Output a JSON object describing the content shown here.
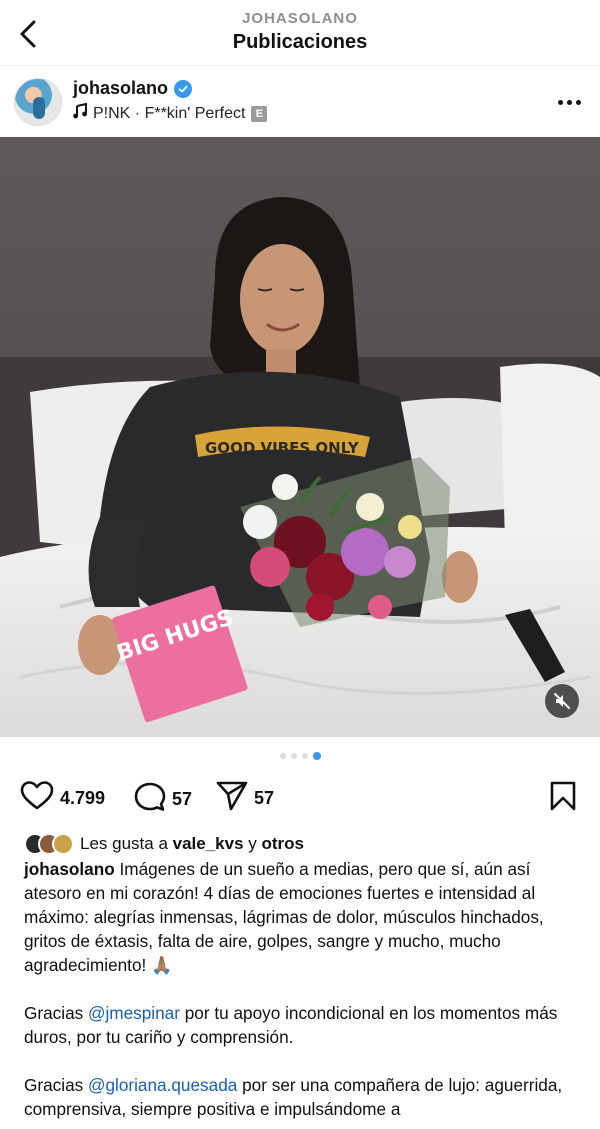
{
  "header": {
    "account": "JOHASOLANO",
    "title": "Publicaciones"
  },
  "post": {
    "username": "johasolano",
    "song": "P!NK · F**kin' Perfect",
    "explicit_badge": "E",
    "image_card_text": "BIG HUGS",
    "sweatshirt_text": "GOOD VIBES ONLY",
    "carousel": {
      "total": 4,
      "active_index": 3
    }
  },
  "actions": {
    "likes": "4.799",
    "comments": "57",
    "shares": "57"
  },
  "liked_by": {
    "prefix": "Les gusta a",
    "user": "vale_kvs",
    "connector": "y",
    "others": "otros"
  },
  "caption": {
    "p1_text": "Imágenes de un sueño a medias, pero que sí, aún así atesoro en mi corazón! 4 días de emociones fuertes e intensidad al máximo: alegrías inmensas, lágrimas de dolor, músculos hinchados, gritos de éxtasis, falta de aire, golpes, sangre y mucho, mucho agradecimiento! 🙏🏽",
    "p2_prefix": "Gracias",
    "p2_mention": "@jmespinar",
    "p2_text": "por tu apoyo incondicional en los momentos más duros, por tu cariño y comprensión.",
    "p3_prefix": "Gracias",
    "p3_mention": "@gloriana.quesada",
    "p3_text": "por ser una compañera de lujo: aguerrida, comprensiva, siempre positiva e impulsándome a"
  },
  "colors": {
    "accent": "#3897f0",
    "mention": "#1a5fb4",
    "muted": "#8e8e8e"
  },
  "icons": [
    "back-arrow-icon",
    "verified-badge-icon",
    "music-note-icon",
    "more-options-icon",
    "mute-icon",
    "heart-icon",
    "comment-icon",
    "share-icon",
    "bookmark-icon"
  ]
}
